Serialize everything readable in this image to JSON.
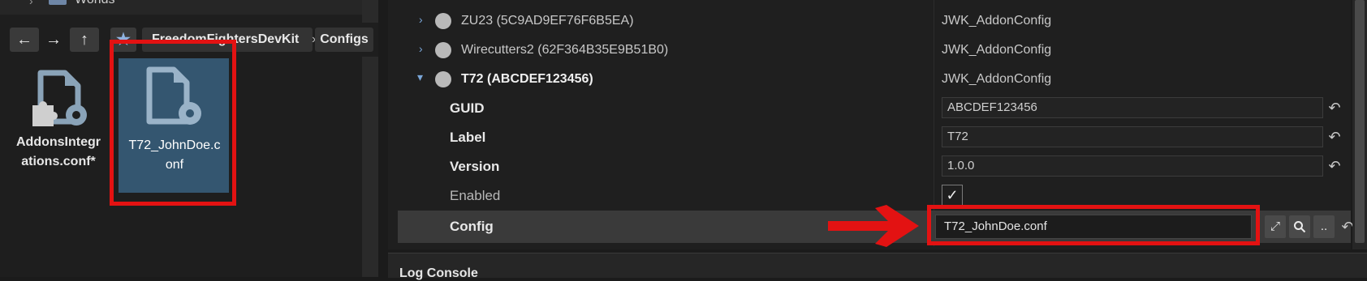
{
  "file_browser": {
    "tree_item_label": "Worlds",
    "nav": {
      "back_glyph": "←",
      "forward_glyph": "→",
      "up_glyph": "↑",
      "favorite_glyph": "★"
    },
    "breadcrumb": [
      "FreedomFightersDevKit",
      "Configs"
    ],
    "files": [
      {
        "name": "AddonsIntegrations.conf*",
        "name_lines": [
          "AddonsIntegr",
          "ations.conf*"
        ],
        "icon": "config-file-with-puzzle-icon"
      },
      {
        "name": "T72_JohnDoe.conf",
        "name_lines": [
          "T72_JohnDoe.c",
          "onf"
        ],
        "icon": "config-file-icon",
        "selected": true
      }
    ]
  },
  "properties": {
    "rows": [
      {
        "label": "ZU23 (5C9AD9EF76F6B5EA)",
        "value": "JWK_AddonConfig",
        "expanded": false
      },
      {
        "label": "Wirecutters2 (62F364B35E9B51B0)",
        "value": "JWK_AddonConfig",
        "expanded": false
      },
      {
        "label": "T72 (ABCDEF123456)",
        "value": "JWK_AddonConfig",
        "expanded": true
      }
    ],
    "fields": {
      "guid": {
        "label": "GUID",
        "value": "ABCDEF123456"
      },
      "label": {
        "label": "Label",
        "value": "T72"
      },
      "version": {
        "label": "Version",
        "value": "1.0.0"
      },
      "enabled": {
        "label": "Enabled",
        "checked": true
      },
      "config": {
        "label": "Config",
        "value": "T72_JohnDoe.conf"
      }
    },
    "config_buttons": {
      "open_glyph": "⤢",
      "browse_glyph": "..",
      "revert_glyph": "↶"
    }
  },
  "log_console": {
    "title": "Log Console"
  },
  "colors": {
    "highlight": "#e31212",
    "selection": "#345670",
    "accent_expander": "#7aa6d8"
  }
}
